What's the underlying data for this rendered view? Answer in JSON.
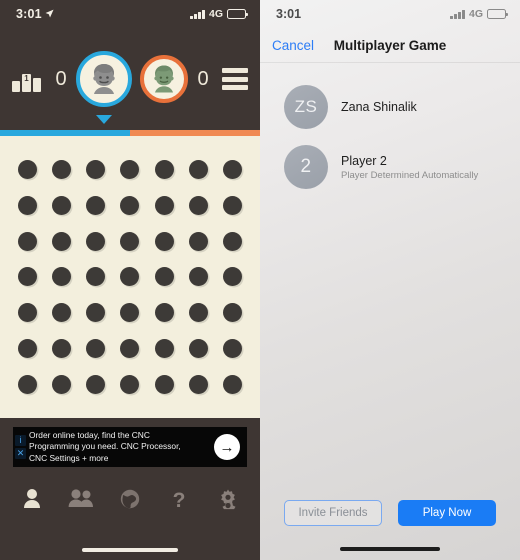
{
  "left_screen": {
    "status_bar": {
      "time": "3:01",
      "location_icon": "location-arrow-icon",
      "network": "4G",
      "signal_icon": "signal-bars-icon",
      "battery_icon": "battery-icon"
    },
    "header": {
      "leaderboard_icon": "podium-icon",
      "menu_icon": "list-menu-icon",
      "player1": {
        "score": "0",
        "avatar_icon": "player1-avatar-icon",
        "ring_color": "#29a8dd",
        "active": true
      },
      "player2": {
        "score": "0",
        "avatar_icon": "player2-avatar-icon",
        "ring_color": "#e8713a",
        "active": false
      },
      "turn_caret_color": "#29a8dd"
    },
    "turn_bar": {
      "left_color": "#29a8dd",
      "right_color": "#f08a52",
      "left_percent": 50
    },
    "board": {
      "columns": 7,
      "rows": 7,
      "hole_color": "#3d3a37",
      "background": "#f3efdd"
    },
    "ad": {
      "line1": "Order online today, find the CNC",
      "line2": "Programming you need. CNC Processor,",
      "line3": "CNC Settings + more",
      "info_badge": "i",
      "close_badge": "✕",
      "arrow_icon": "arrow-right-icon"
    },
    "tabs": [
      {
        "name": "profile",
        "icon": "person-icon",
        "active": true
      },
      {
        "name": "friends",
        "icon": "people-icon",
        "active": false
      },
      {
        "name": "world",
        "icon": "globe-icon",
        "active": false
      },
      {
        "name": "help",
        "icon": "question-mark-icon",
        "active": false
      },
      {
        "name": "settings",
        "icon": "gear-icon",
        "active": false
      }
    ]
  },
  "right_screen": {
    "status_bar": {
      "time": "3:01",
      "network": "4G",
      "signal_icon": "signal-bars-icon",
      "battery_icon": "battery-icon"
    },
    "navbar": {
      "cancel_label": "Cancel",
      "title": "Multiplayer Game"
    },
    "players": [
      {
        "initials": "ZS",
        "name": "Zana Shinalik",
        "subtitle": ""
      },
      {
        "initials": "2",
        "name": "Player 2",
        "subtitle": "Player Determined Automatically"
      }
    ],
    "buttons": {
      "invite_label": "Invite Friends",
      "play_label": "Play Now",
      "primary_color": "#1a7cf5"
    }
  }
}
